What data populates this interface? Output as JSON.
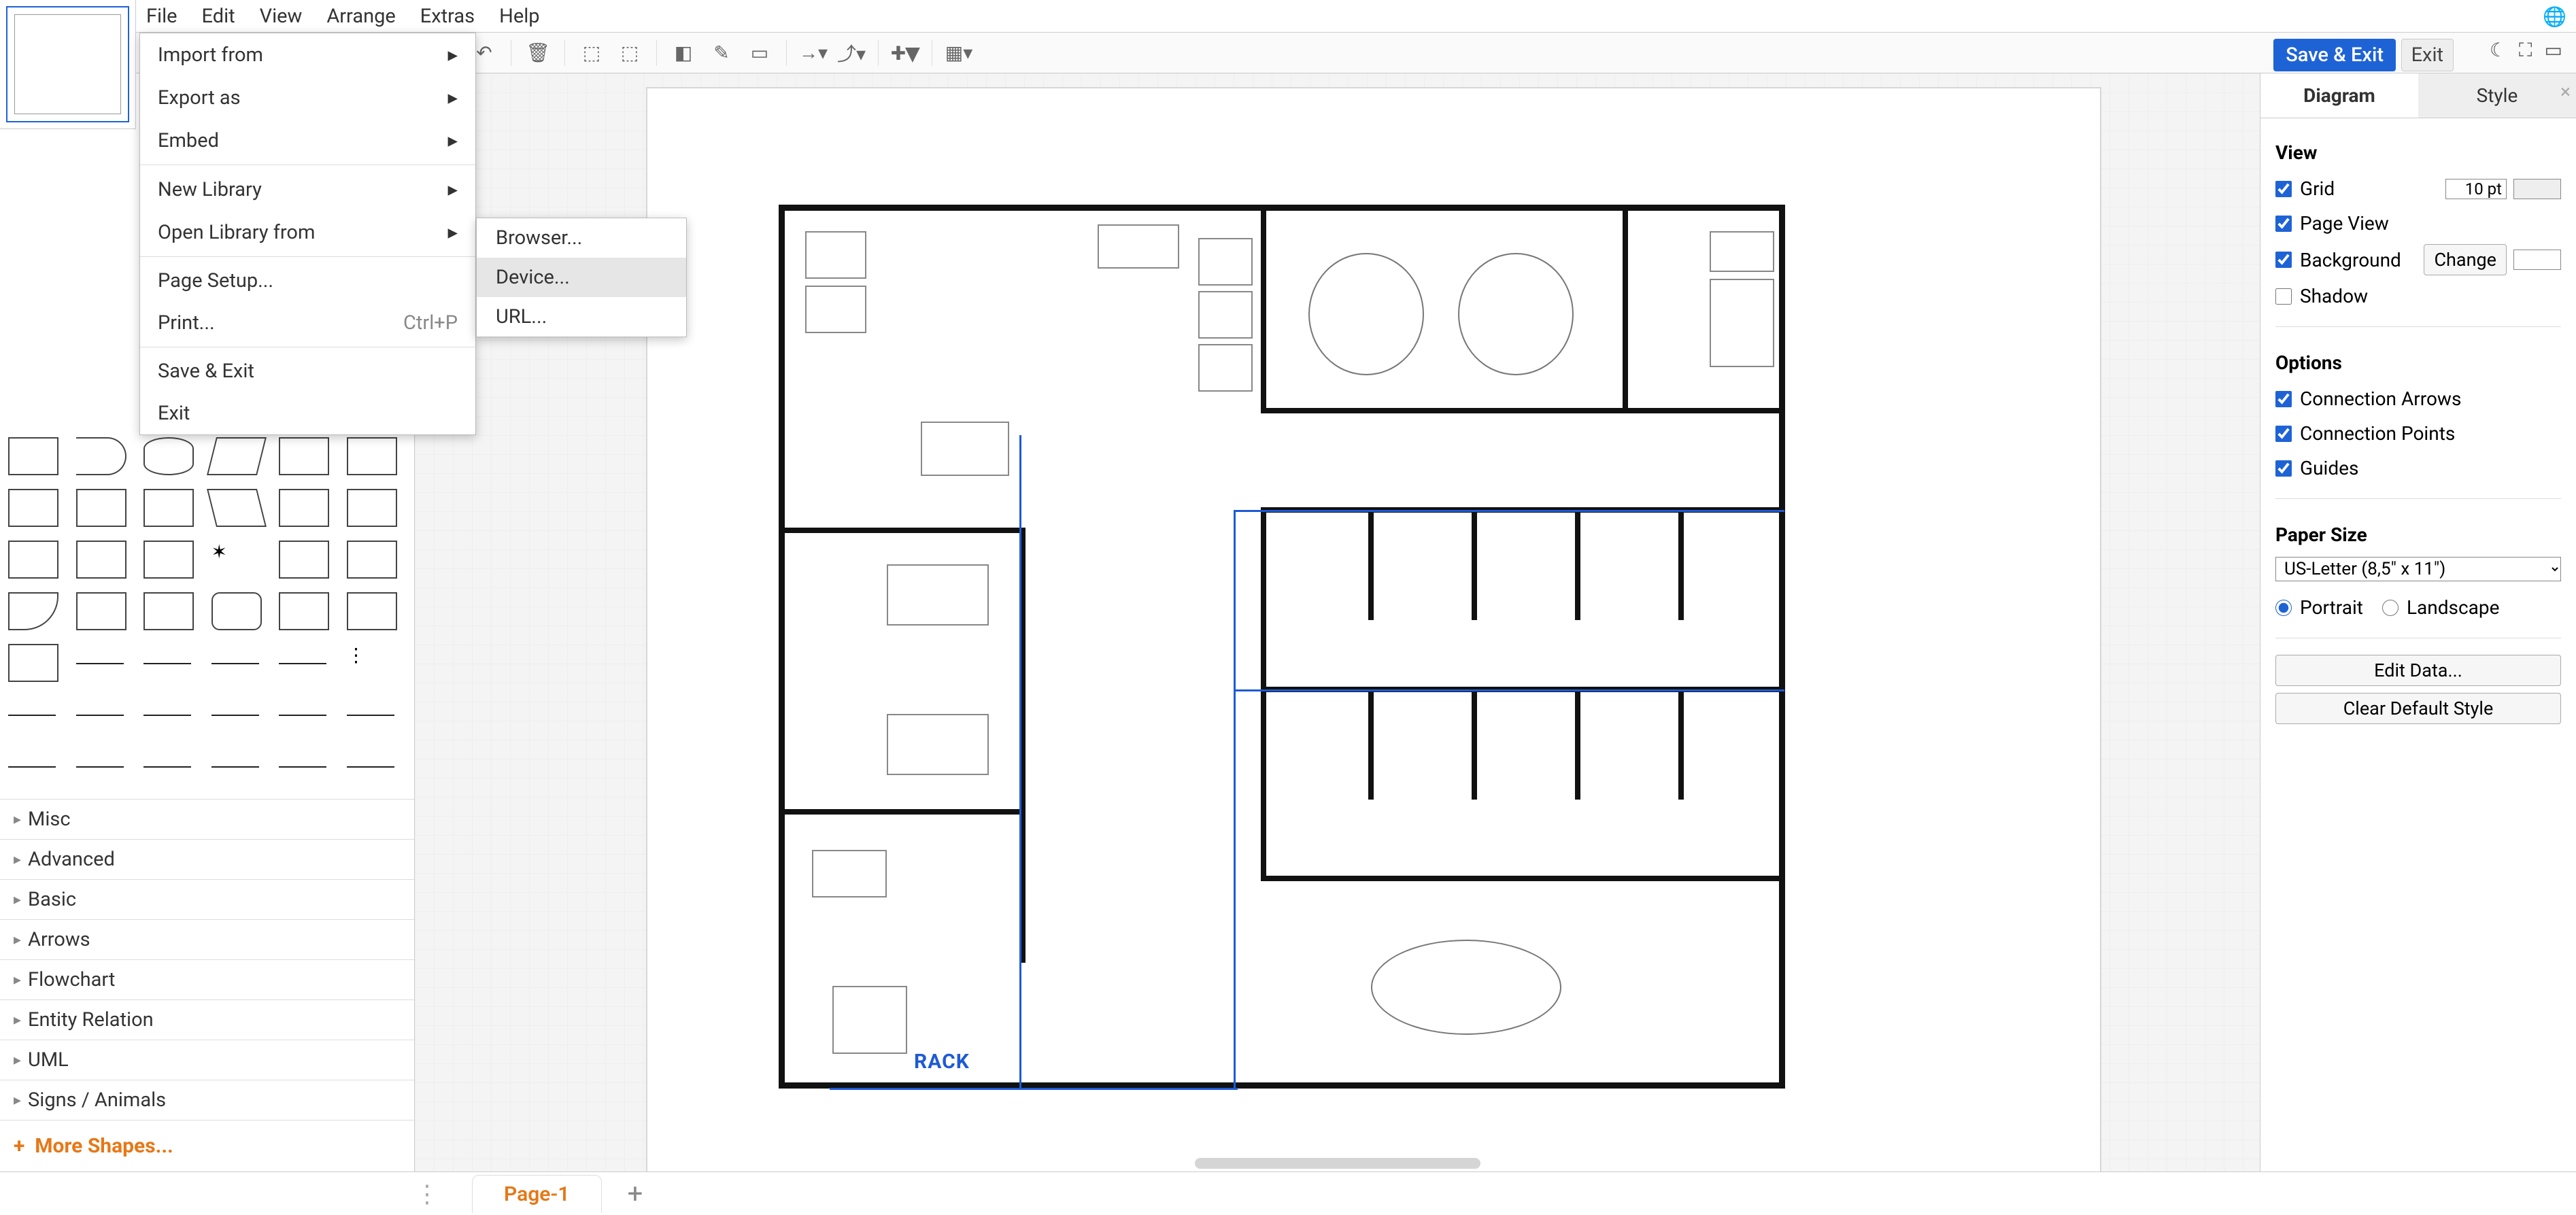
{
  "menubar": {
    "items": [
      "File",
      "Edit",
      "View",
      "Arrange",
      "Extras",
      "Help"
    ]
  },
  "fileMenu": {
    "items": [
      {
        "label": "Import from",
        "sub": true
      },
      {
        "label": "Export as",
        "sub": true
      },
      {
        "label": "Embed",
        "sub": true
      },
      {
        "sep": true
      },
      {
        "label": "New Library",
        "sub": true
      },
      {
        "label": "Open Library from",
        "sub": true
      },
      {
        "sep": true
      },
      {
        "label": "Page Setup..."
      },
      {
        "label": "Print...",
        "shortcut": "Ctrl+P"
      },
      {
        "sep": true
      },
      {
        "label": "Save & Exit"
      },
      {
        "label": "Exit"
      }
    ]
  },
  "openLibSubmenu": {
    "items": [
      "Browser...",
      "Device...",
      "URL..."
    ],
    "highlighted": 1
  },
  "actions": {
    "saveExit": "Save & Exit",
    "exit": "Exit"
  },
  "sidebar": {
    "categories": [
      "Misc",
      "Advanced",
      "Basic",
      "Arrows",
      "Flowchart",
      "Entity Relation",
      "UML",
      "Signs / Animals"
    ],
    "more": "More Shapes..."
  },
  "pages": {
    "current": "Page-1"
  },
  "right": {
    "tabs": [
      "Diagram",
      "Style"
    ],
    "active": 0,
    "view": {
      "heading": "View",
      "grid": "Grid",
      "gridVal": "10 pt",
      "pageView": "Page View",
      "background": "Background",
      "changeBtn": "Change",
      "shadow": "Shadow",
      "gridChecked": true,
      "pageViewChecked": true,
      "backgroundChecked": true,
      "shadowChecked": false
    },
    "options": {
      "heading": "Options",
      "connArrows": "Connection Arrows",
      "connPoints": "Connection Points",
      "guides": "Guides",
      "arrowsChecked": true,
      "pointsChecked": true,
      "guidesChecked": true
    },
    "paper": {
      "heading": "Paper Size",
      "value": "US-Letter (8,5\" x 11\")",
      "portrait": "Portrait",
      "landscape": "Landscape",
      "orientation": "portrait"
    },
    "buttons": {
      "editData": "Edit Data...",
      "clearStyle": "Clear Default Style"
    }
  },
  "canvas": {
    "rackLabel": "RACK"
  }
}
